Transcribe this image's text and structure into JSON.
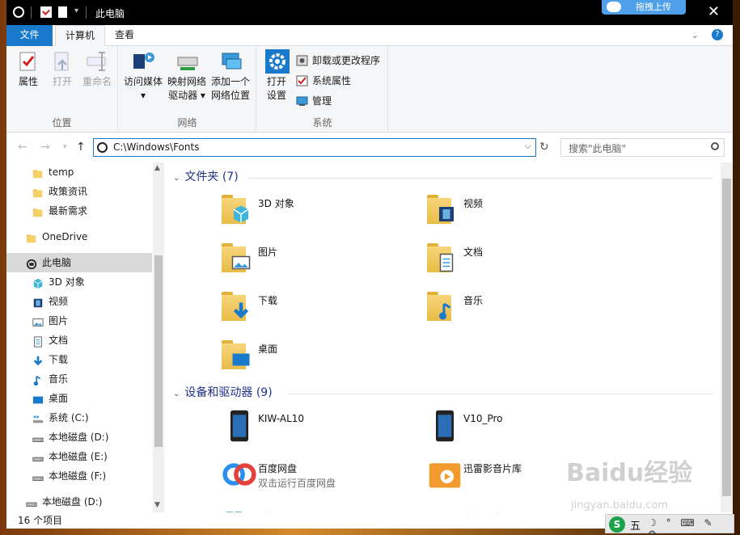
{
  "window": {
    "title": "此电脑",
    "upload_label": "拖拽上传",
    "close_glyph": "✕"
  },
  "ribbon_tabs": [
    {
      "label": "文件"
    },
    {
      "label": "计算机"
    },
    {
      "label": "查看"
    }
  ],
  "ribbon": {
    "groups": {
      "location": {
        "label": "位置",
        "buttons": [
          {
            "label": "属性",
            "icon": "properties-icon",
            "enabled": true
          },
          {
            "label": "打开",
            "icon": "open-icon",
            "enabled": false
          },
          {
            "label": "重命名",
            "icon": "rename-icon",
            "enabled": false
          }
        ]
      },
      "network": {
        "label": "网络",
        "buttons": [
          {
            "label1": "访问媒体",
            "label2": "▾",
            "icon": "media-icon"
          },
          {
            "label1": "映射网络",
            "label2": "驱动器 ▾",
            "icon": "map-drive-icon"
          },
          {
            "label1": "添加一个",
            "label2": "网络位置",
            "icon": "network-location-icon"
          }
        ]
      },
      "system": {
        "label": "系统",
        "open_settings": {
          "label1": "打开",
          "label2": "设置",
          "icon": "settings-gear-icon"
        },
        "small_buttons": [
          {
            "label": "卸载或更改程序",
            "icon": "uninstall-icon"
          },
          {
            "label": "系统属性",
            "icon": "system-properties-icon"
          },
          {
            "label": "管理",
            "icon": "manage-icon"
          }
        ]
      }
    }
  },
  "address": {
    "path": "C:\\Windows\\Fonts",
    "search_placeholder": "搜索\"此电脑\""
  },
  "nav_pane": {
    "items": [
      {
        "label": "temp",
        "icon": "folder-icon",
        "indent": 2
      },
      {
        "label": "政策资讯",
        "icon": "folder-icon",
        "indent": 2
      },
      {
        "label": "最新需求",
        "icon": "folder-icon",
        "indent": 2
      },
      {
        "label": "OneDrive",
        "icon": "onedrive-folder-icon",
        "indent": 1
      },
      {
        "label": "此电脑",
        "icon": "this-pc-icon",
        "indent": 1,
        "selected": true
      },
      {
        "label": "3D 对象",
        "icon": "3d-objects-icon",
        "indent": 2
      },
      {
        "label": "视频",
        "icon": "video-icon",
        "indent": 2
      },
      {
        "label": "图片",
        "icon": "pictures-icon",
        "indent": 2
      },
      {
        "label": "文档",
        "icon": "documents-icon",
        "indent": 2
      },
      {
        "label": "下载",
        "icon": "download-icon",
        "indent": 2
      },
      {
        "label": "音乐",
        "icon": "music-icon",
        "indent": 2
      },
      {
        "label": "桌面",
        "icon": "desktop-icon",
        "indent": 2
      },
      {
        "label": "系统 (C:)",
        "icon": "system-drive-icon",
        "indent": 2
      },
      {
        "label": "本地磁盘 (D:)",
        "icon": "drive-icon",
        "indent": 2
      },
      {
        "label": "本地磁盘 (E:)",
        "icon": "drive-icon",
        "indent": 2
      },
      {
        "label": "本地磁盘 (F:)",
        "icon": "drive-icon",
        "indent": 2
      },
      {
        "label": "本地磁盘 (D:)",
        "icon": "drive-icon",
        "indent": 1
      }
    ]
  },
  "content": {
    "folders_header": "文件夹 (7)",
    "folders": [
      {
        "label": "3D 对象",
        "icon": "3d-objects-icon"
      },
      {
        "label": "视频",
        "icon": "video-icon"
      },
      {
        "label": "图片",
        "icon": "pictures-icon"
      },
      {
        "label": "文档",
        "icon": "documents-icon"
      },
      {
        "label": "下载",
        "icon": "download-icon"
      },
      {
        "label": "音乐",
        "icon": "music-icon"
      },
      {
        "label": "桌面",
        "icon": "desktop-icon"
      }
    ],
    "devices_header": "设备和驱动器 (9)",
    "devices": [
      {
        "label": "KIW-AL10",
        "sub": "",
        "icon": "phone-icon"
      },
      {
        "label": "V10_Pro",
        "sub": "",
        "icon": "phone-icon"
      },
      {
        "label": "百度网盘",
        "sub": "双击运行百度网盘",
        "icon": "baidu-netdisk-icon"
      },
      {
        "label": "迅雷影音片库",
        "sub": "",
        "icon": "xunlei-media-icon"
      },
      {
        "label": "系统 (C:)",
        "sub": "",
        "icon": "system-drive-icon"
      },
      {
        "label": "本地磁盘 (D:)",
        "sub": "",
        "icon": "drive-icon"
      }
    ]
  },
  "status": {
    "item_count": "16 个项目"
  },
  "ime": {
    "mode": "五",
    "glyphs": "☽ ° ⌨ ✎ ⚙"
  },
  "watermark": {
    "text": "Baidu经验",
    "url": "jingyan.baidu.com"
  },
  "colors": {
    "accent": "#1979ca",
    "section_header": "#1e3287",
    "selected_bg": "#d9d9d9"
  }
}
